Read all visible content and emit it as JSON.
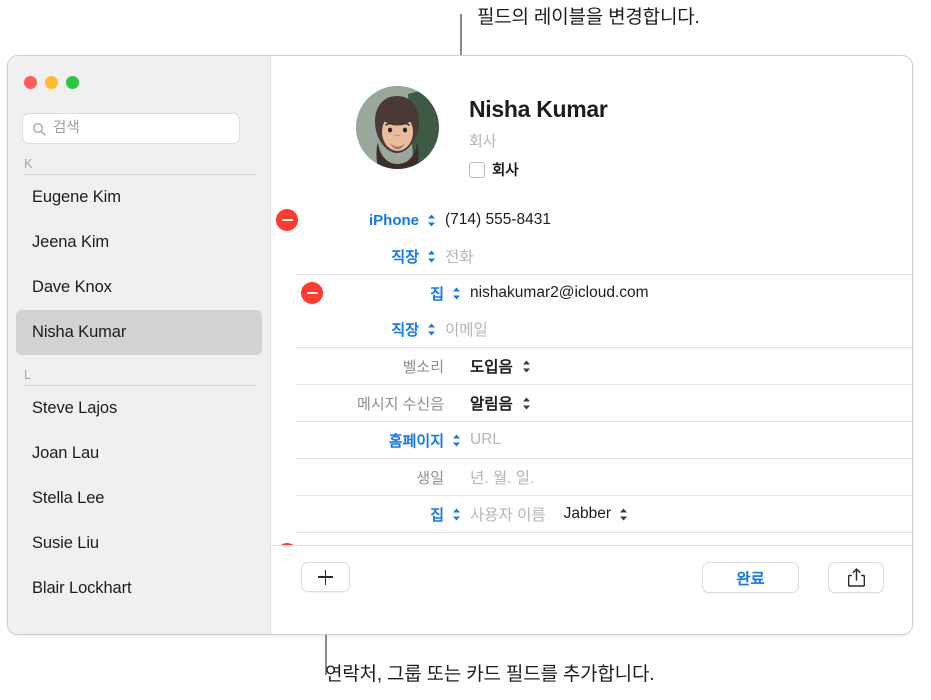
{
  "callouts": {
    "top": "필드의 레이블을 변경합니다.",
    "bottom": "연락처, 그룹 또는 카드 필드를 추가합니다."
  },
  "window": {
    "traffic_lights": [
      {
        "name": "close",
        "color": "#ff5f57"
      },
      {
        "name": "minimize",
        "color": "#febc2e"
      },
      {
        "name": "zoom",
        "color": "#28c840"
      }
    ]
  },
  "sidebar": {
    "search": {
      "placeholder": "검색",
      "value": "",
      "icon": "search-icon"
    },
    "groups": [
      {
        "header": "K",
        "contacts": [
          {
            "name": "Eugene Kim",
            "selected": false
          },
          {
            "name": "Jeena Kim",
            "selected": false
          },
          {
            "name": "Dave Knox",
            "selected": false
          },
          {
            "name": "Nisha Kumar",
            "selected": true
          }
        ]
      },
      {
        "header": "L",
        "contacts": [
          {
            "name": "Steve Lajos",
            "selected": false
          },
          {
            "name": "Joan Lau",
            "selected": false
          },
          {
            "name": "Stella Lee",
            "selected": false
          },
          {
            "name": "Susie Liu",
            "selected": false
          },
          {
            "name": "Blair Lockhart",
            "selected": false
          }
        ]
      }
    ]
  },
  "card": {
    "name": "Nisha  Kumar",
    "company_placeholder": "회사",
    "company_checkbox_label": "회사",
    "company_checked": false,
    "avatar_alt": "avatar",
    "fields": [
      {
        "id": "phone-iphone",
        "deletable": true,
        "separator": false,
        "label": "iPhone",
        "label_style": "link",
        "stepper": true,
        "value": "(714) 555-8431",
        "is_placeholder": false
      },
      {
        "id": "phone-work",
        "deletable": false,
        "separator": false,
        "label": "직장",
        "label_style": "link",
        "stepper": true,
        "value": "전화",
        "is_placeholder": true
      },
      {
        "id": "email-home",
        "deletable": true,
        "separator": true,
        "label": "집",
        "label_style": "link",
        "stepper": true,
        "value": "nishakumar2@icloud.com",
        "is_placeholder": false
      },
      {
        "id": "email-work",
        "deletable": false,
        "separator": false,
        "label": "직장",
        "label_style": "link",
        "stepper": true,
        "value": "이메일",
        "is_placeholder": true
      },
      {
        "id": "ringtone",
        "deletable": false,
        "separator": true,
        "label": "벨소리",
        "label_style": "muted",
        "stepper": false,
        "value": "도입음",
        "is_placeholder": false,
        "value_bold": true,
        "value_stepper": true
      },
      {
        "id": "text-tone",
        "deletable": false,
        "separator": true,
        "label": "메시지 수신음",
        "label_style": "muted",
        "stepper": false,
        "value": "알림음",
        "is_placeholder": false,
        "value_bold": true,
        "value_stepper": true
      },
      {
        "id": "homepage",
        "deletable": false,
        "separator": true,
        "label": "홈페이지",
        "label_style": "link",
        "stepper": true,
        "value": "URL",
        "is_placeholder": true
      },
      {
        "id": "birthday",
        "deletable": false,
        "separator": true,
        "label": "생일",
        "label_style": "muted",
        "stepper": false,
        "value": "년. 월. 일.",
        "is_placeholder": true
      },
      {
        "id": "instant-message",
        "deletable": false,
        "separator": true,
        "label": "집",
        "label_style": "link",
        "stepper": true,
        "value": "사용자 이름",
        "is_placeholder": true,
        "extra_value": "Jabber",
        "extra_stepper": true
      }
    ]
  },
  "toolbar": {
    "add_label": "+",
    "add_icon": "plus-icon",
    "done_label": "완료",
    "share_icon": "share-icon"
  }
}
